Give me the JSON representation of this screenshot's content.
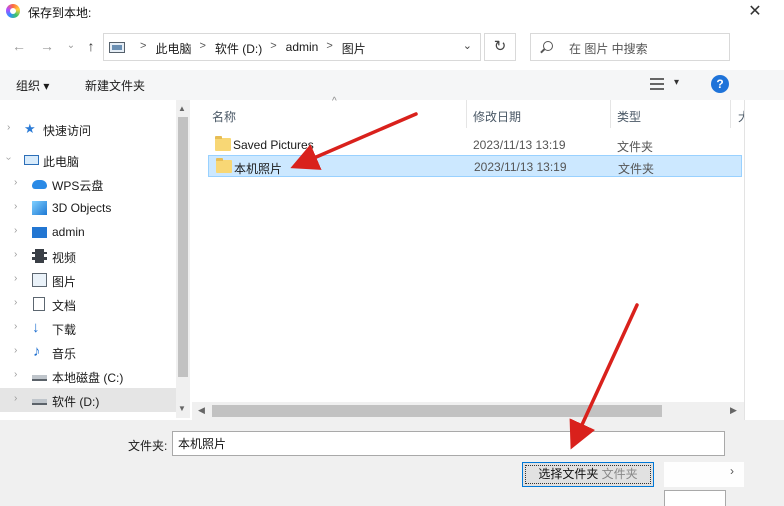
{
  "window": {
    "title": "保存到本地:",
    "close_glyph": "✕"
  },
  "nav": {
    "back_glyph": "←",
    "forward_glyph": "→",
    "recent_glyph": "⌄",
    "up_glyph": "↑",
    "breadcrumbs": [
      "此电脑",
      "软件 (D:)",
      "admin",
      "图片"
    ],
    "breadcrumb_sep": ">",
    "dropdown_glyph": "⌄",
    "refresh_glyph": "↻",
    "search_placeholder": "在 图片 中搜索"
  },
  "toolbar": {
    "organize_label": "组织 ▾",
    "new_folder_label": "新建文件夹",
    "view_dropdown_glyph": "▾",
    "help_label": "?"
  },
  "sidebar": {
    "items": [
      {
        "label": "快速访问",
        "icon": "star-icon"
      },
      {
        "label": "此电脑",
        "icon": "computer-icon"
      },
      {
        "label": "WPS云盘",
        "icon": "cloud-icon"
      },
      {
        "label": "3D Objects",
        "icon": "cube-icon"
      },
      {
        "label": "admin",
        "icon": "desktop-icon"
      },
      {
        "label": "视频",
        "icon": "video-icon"
      },
      {
        "label": "图片",
        "icon": "picture-icon"
      },
      {
        "label": "文档",
        "icon": "document-icon"
      },
      {
        "label": "下载",
        "icon": "download-icon"
      },
      {
        "label": "音乐",
        "icon": "music-icon"
      },
      {
        "label": "本地磁盘 (C:)",
        "icon": "drive-icon"
      },
      {
        "label": "软件 (D:)",
        "icon": "drive-icon"
      }
    ],
    "selected": "软件 (D:)"
  },
  "columns": {
    "name": "名称",
    "modified": "修改日期",
    "type": "类型",
    "more": "大"
  },
  "files": [
    {
      "name": "Saved Pictures",
      "modified": "2023/11/13 13:19",
      "type": "文件夹"
    },
    {
      "name": "本机照片",
      "modified": "2023/11/13 13:19",
      "type": "文件夹"
    }
  ],
  "selected_file": "本机照片",
  "footer": {
    "folder_label": "文件夹:",
    "folder_value": "本机照片",
    "select_button": "选择文件夹",
    "select_button_overlay": "文件夹"
  },
  "colors": {
    "selection": "#cce8ff",
    "accent": "#0078d7",
    "annotation_arrow": "#d9211c",
    "folder": "#f8d775"
  }
}
